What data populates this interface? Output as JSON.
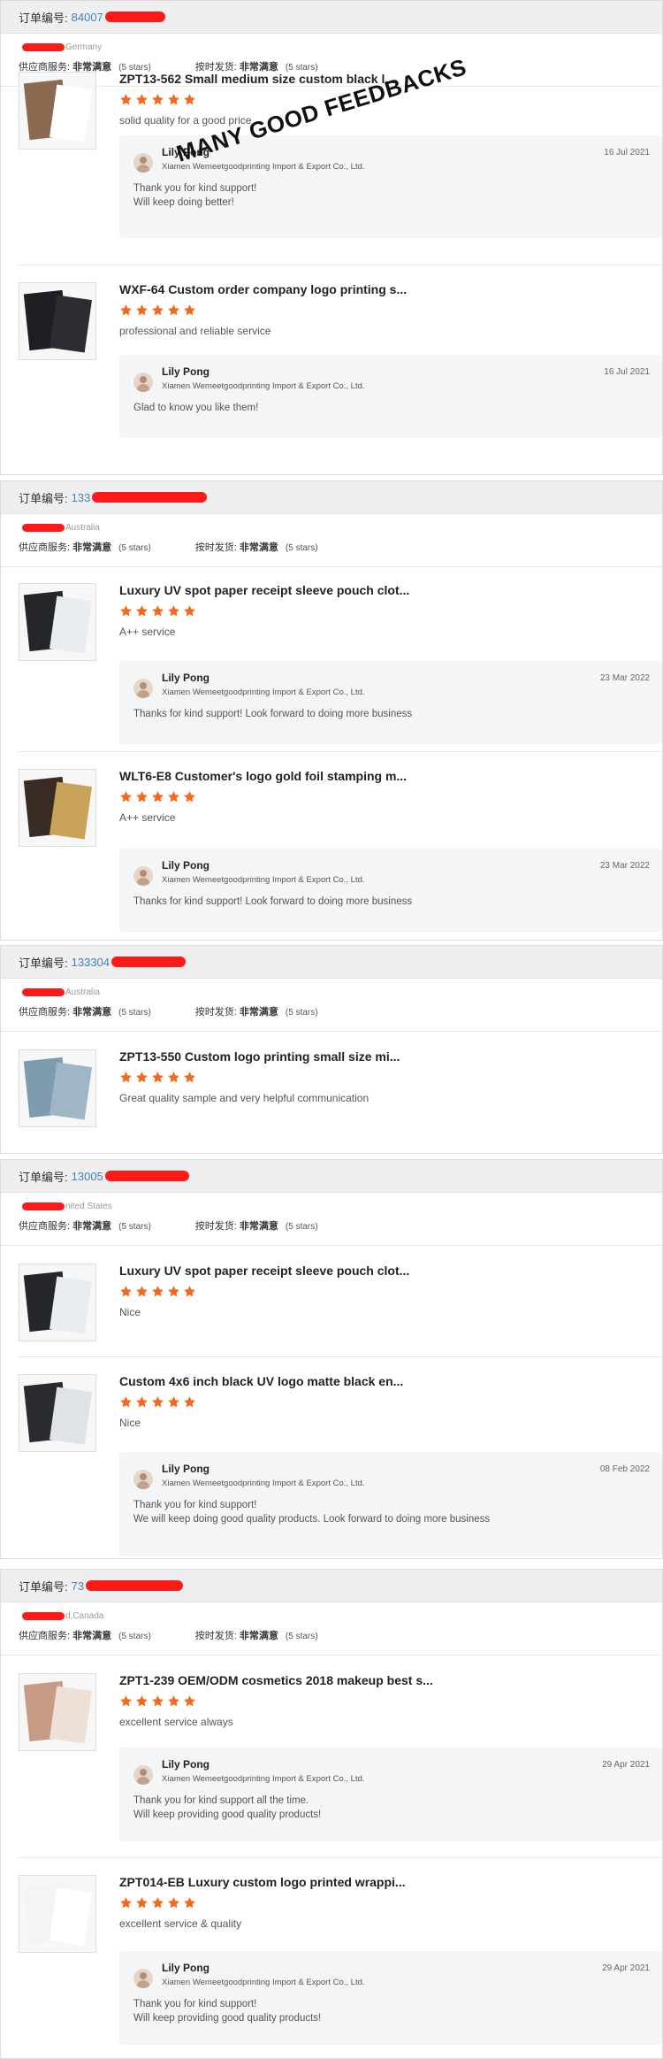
{
  "labels": {
    "order_no": "订单编号:",
    "supplier_service": "供应商服务:",
    "on_time_delivery": "按时发货:",
    "rating_value": "非常满意",
    "rating_stars": "(5 stars)",
    "seller_name": "Lily Pong",
    "seller_company": "Xiamen Wemeetgoodprinting Import & Export Co., Ltd."
  },
  "watermark": "MANY GOOD FEEDBACKS",
  "colors": {
    "star": "#f26b1d",
    "order_link": "#3d82c4",
    "redaction": "#ff1a1a"
  },
  "orders": [
    {
      "order_no": "84007",
      "country": "Germany",
      "items": [
        {
          "title": "ZPT13-562 Small medium size custom black l...",
          "comment": "solid quality for a good price",
          "rating": 5,
          "reply_date": "16 Jul 2021",
          "reply": [
            "Thank you for kind support!",
            "Will keep doing better!"
          ]
        },
        {
          "title": "WXF-64 Custom order company logo printing s...",
          "comment": "professional and reliable service",
          "rating": 5,
          "reply_date": "16 Jul 2021",
          "reply": [
            "Glad to know you like them!"
          ]
        }
      ]
    },
    {
      "order_no": "133",
      "country": "Australia",
      "items": [
        {
          "title": "Luxury UV spot paper receipt sleeve pouch clot...",
          "comment": "A++ service",
          "rating": 5,
          "reply_date": "23 Mar 2022",
          "reply": [
            "Thanks for kind support! Look forward to doing more business"
          ]
        },
        {
          "title": "WLT6-E8 Customer's logo gold foil stamping m...",
          "comment": "A++ service",
          "rating": 5,
          "reply_date": "23 Mar 2022",
          "reply": [
            "Thanks for kind support! Look forward to doing more business"
          ]
        }
      ]
    },
    {
      "order_no": "133304",
      "country": "Australia",
      "items": [
        {
          "title": "ZPT13-550 Custom logo printing small size mi...",
          "comment": "Great quality sample and very helpful communication",
          "rating": 5
        }
      ]
    },
    {
      "order_no": "13005",
      "country": "nited States",
      "items": [
        {
          "title": "Luxury UV spot paper receipt sleeve pouch clot...",
          "comment": "Nice",
          "rating": 5
        },
        {
          "title": "Custom 4x6 inch black UV logo matte black en...",
          "comment": "Nice",
          "rating": 5,
          "reply_date": "08 Feb 2022",
          "reply": [
            "Thank you for kind support!",
            "We will keep doing good quality products. Look forward to doing more business"
          ]
        }
      ]
    },
    {
      "order_no": "73",
      "country": "d,Canada",
      "items": [
        {
          "title": "ZPT1-239 OEM/ODM cosmetics 2018 makeup best s...",
          "comment": "excellent service always",
          "rating": 5,
          "reply_date": "29 Apr 2021",
          "reply": [
            "Thank you for kind support all the time.",
            "Will keep providing good quality products!"
          ]
        },
        {
          "title": "ZPT014-EB Luxury custom logo printed wrappi...",
          "comment": "excellent service & quality",
          "rating": 5,
          "reply_date": "29 Apr 2021",
          "reply": [
            "Thank you for kind support!",
            "Will keep providing good quality products!"
          ]
        }
      ]
    }
  ]
}
